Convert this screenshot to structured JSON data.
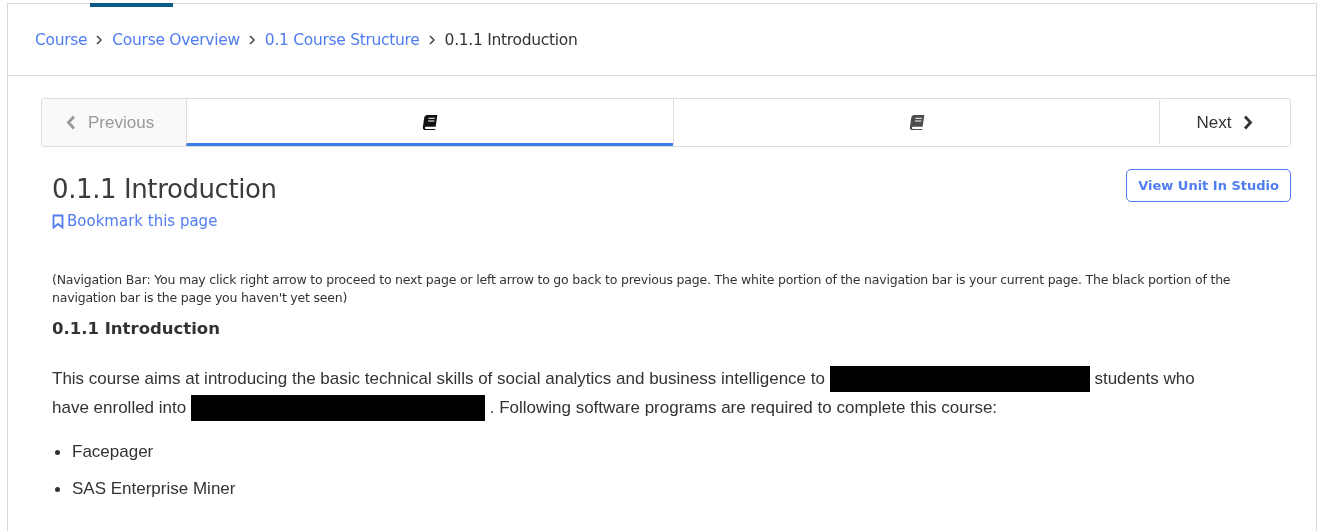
{
  "breadcrumb": [
    {
      "label": "Course",
      "kind": "link"
    },
    {
      "label": "Course Overview",
      "kind": "link"
    },
    {
      "label": "0.1 Course Structure",
      "kind": "link"
    },
    {
      "label": "0.1.1 Introduction",
      "kind": "current"
    }
  ],
  "sequence_nav": {
    "previous": {
      "label": "Previous",
      "disabled": true
    },
    "units": [
      {
        "selected": true
      },
      {
        "selected": false
      }
    ],
    "next": {
      "label": "Next",
      "disabled": false
    }
  },
  "unit": {
    "title": "0.1.1 Introduction",
    "studio_button": "View Unit In Studio",
    "bookmark": "Bookmark this page"
  },
  "note": "(Navigation Bar: You may click right arrow to proceed to next page or left arrow to go back to previous page. The white portion of the navigation bar is your current page. The black portion of the navigation bar is the page you haven't yet seen)",
  "heading": "0.1.1 Introduction",
  "paragraph": [
    {
      "kind": "text",
      "text": "This course aims at introducing the basic technical skills of social analytics and business intelligence to"
    },
    {
      "kind": "redaction"
    },
    {
      "kind": "text",
      "text": "students who"
    },
    {
      "kind": "break"
    },
    {
      "kind": "text",
      "text": "have enrolled into"
    },
    {
      "kind": "redaction"
    },
    {
      "kind": "text",
      "text": ". Following software programs are required to complete this course:"
    }
  ],
  "software": [
    "Facepager",
    "SAS Enterprise Miner"
  ]
}
